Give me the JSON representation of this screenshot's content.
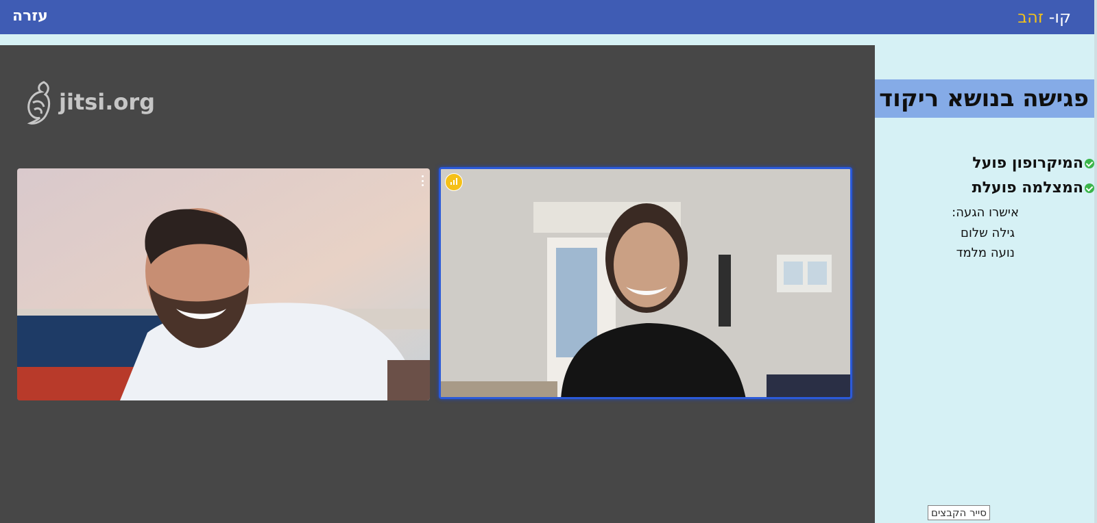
{
  "header": {
    "help_label": "עזרה",
    "brand_prefix": "קו-",
    "brand_highlight": "זהב",
    "bar_color": "#3f5cb4",
    "highlight_color": "#f2c21b"
  },
  "stage": {
    "watermark": "jitsi.org",
    "participants": [
      {
        "tile": "left",
        "menu_icon": "more-vertical-icon"
      },
      {
        "tile": "right",
        "dominant_speaker": true,
        "audio_icon": "audio-level-icon"
      }
    ]
  },
  "sidebar": {
    "meeting_title": "פגישה בנושא ריקוד",
    "status": [
      {
        "label": "המיקרופון פועל",
        "icon": "check-circle-icon",
        "color": "#3bb54a"
      },
      {
        "label": "המצלמה פועלת",
        "icon": "check-circle-icon",
        "color": "#3bb54a"
      }
    ],
    "arrivals_heading": "אישרו הגעה:",
    "arrivals": [
      "גילה שלום",
      "נועה מלמד"
    ]
  },
  "tooltip": "סייר הקבצים"
}
